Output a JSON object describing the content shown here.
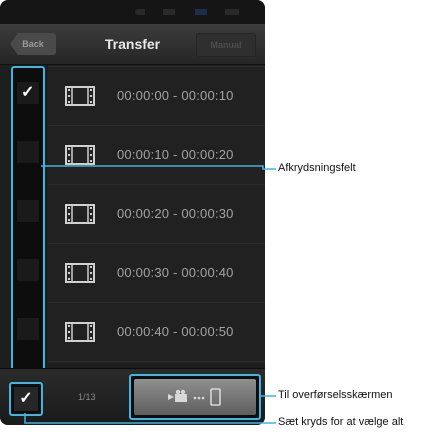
{
  "navbar": {
    "back_label": "Back",
    "title": "Transfer",
    "manual_label": "Manual"
  },
  "rows": [
    {
      "time": "00:00:00 - 00:00:10",
      "checked": true
    },
    {
      "time": "00:00:10 - 00:00:20",
      "checked": false
    },
    {
      "time": "00:00:20 - 00:00:30",
      "checked": false
    },
    {
      "time": "00:00:30 - 00:00:40",
      "checked": false
    },
    {
      "time": "00:00:40 - 00:00:50",
      "checked": false
    }
  ],
  "bottom": {
    "page_count": "1/13",
    "transfer_icons": [
      "camcorder-icon",
      "dots-icon",
      "phone-icon"
    ]
  },
  "icons": {
    "checkmark": "✓",
    "row_icon": "film-strip-icon"
  },
  "callouts": {
    "checkboxes": "Afkrydsningsfelt",
    "transfer_screen": "Til overførselsskærmen",
    "select_all": "Sæt kryds for at vælge alt"
  },
  "colors": {
    "accent": "#3fb6e2",
    "background": "#1e1e1e",
    "text_dim": "#a3a3a3"
  }
}
